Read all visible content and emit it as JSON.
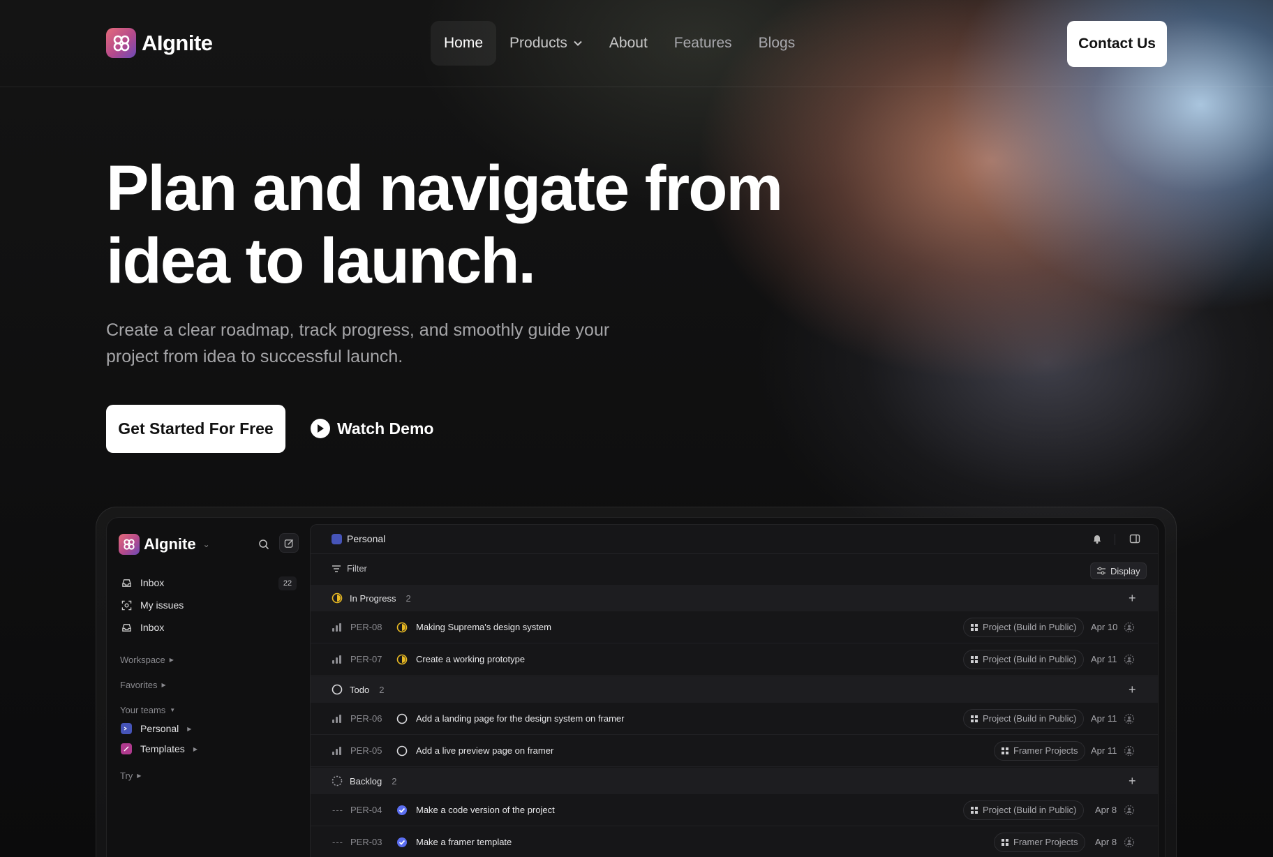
{
  "nav": {
    "brand": "AIgnite",
    "links": [
      {
        "label": "Home"
      },
      {
        "label": "Products"
      },
      {
        "label": "About"
      },
      {
        "label": "Features"
      },
      {
        "label": "Blogs"
      }
    ],
    "contact": "Contact Us"
  },
  "hero": {
    "title_line1": "Plan and navigate from",
    "title_line2": "idea to launch.",
    "subtitle_line1": "Create a clear roadmap, track progress, and smoothly guide your",
    "subtitle_line2": "project from idea to successful launch.",
    "cta_primary": "Get Started For Free",
    "cta_demo": "Watch Demo"
  },
  "app": {
    "sidebar": {
      "brand": "AIgnite",
      "items": [
        {
          "label": "Inbox",
          "count": "22"
        },
        {
          "label": "My issues"
        },
        {
          "label": "Inbox"
        }
      ],
      "sections": {
        "workspace": "Workspace",
        "favorites": "Favorites",
        "your_teams": "Your teams",
        "try": "Try"
      },
      "teams": [
        {
          "label": "Personal",
          "color": "#4654b8"
        },
        {
          "label": "Templates",
          "color": "#b03a8e"
        }
      ]
    },
    "topbar": {
      "crumb": "Personal",
      "filter": "Filter",
      "display": "Display"
    },
    "groups": [
      {
        "label": "In Progress",
        "count": "2"
      },
      {
        "label": "Todo",
        "count": "2"
      },
      {
        "label": "Backlog",
        "count": "2"
      }
    ],
    "issues": [
      {
        "id": "PER-08",
        "title": "Making Suprema's design system",
        "project": "Project (Build in Public)",
        "date": "Apr 10"
      },
      {
        "id": "PER-07",
        "title": "Create a working prototype",
        "project": "Project (Build in Public)",
        "date": "Apr 11"
      },
      {
        "id": "PER-06",
        "title": "Add a landing page for the design system on framer",
        "project": "Project (Build in Public)",
        "date": "Apr 11"
      },
      {
        "id": "PER-05",
        "title": "Add a live preview page on framer",
        "project": "Framer Projects",
        "date": "Apr 11"
      },
      {
        "id": "PER-04",
        "title": "Make a code version of the project",
        "project": "Project (Build in Public)",
        "date": "Apr 8"
      },
      {
        "id": "PER-03",
        "title": "Make a framer template",
        "project": "Framer Projects",
        "date": "Apr 8"
      }
    ]
  },
  "colors": {
    "in_progress": "#e8b923",
    "done_blue": "#5b6ef0",
    "background": "#0b0b0c"
  }
}
